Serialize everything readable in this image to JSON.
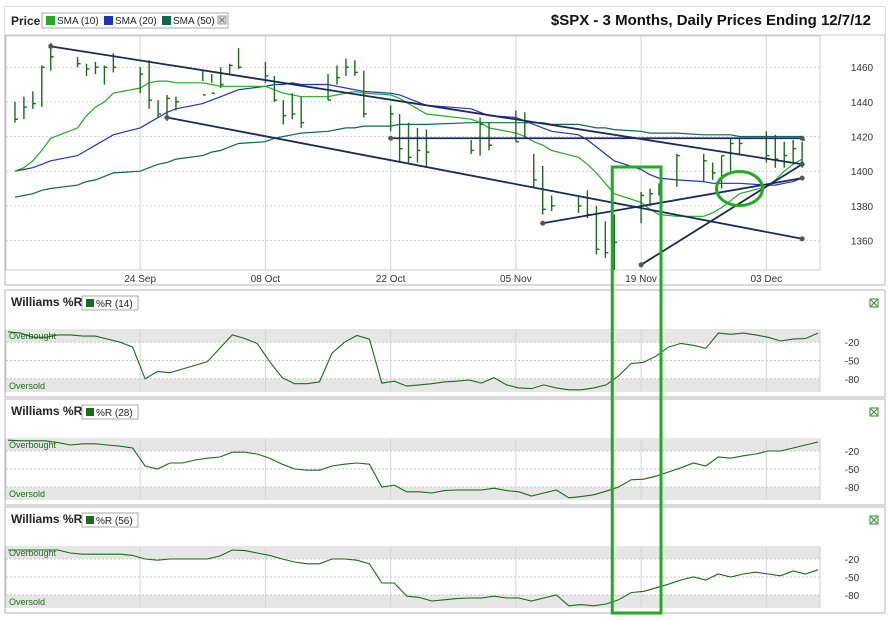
{
  "title": "$SPX - 3 Months, Daily Prices Ending 12/7/12",
  "price_panel": {
    "label": "Price",
    "legend": [
      {
        "label": "SMA (10)",
        "color": "#22aa22"
      },
      {
        "label": "SMA (20)",
        "color": "#2233bb"
      },
      {
        "label": "SMA (50)",
        "color": "#116655"
      }
    ],
    "legend_close_icon": "close-box-icon",
    "y_ticks": [
      "1460",
      "1440",
      "1420",
      "1400",
      "1380",
      "1360"
    ],
    "x_ticks": [
      "24 Sep",
      "08 Oct",
      "22 Oct",
      "05 Nov",
      "19 Nov",
      "03 Dec"
    ]
  },
  "indicator_panels": [
    {
      "title": "Williams %R",
      "legend": "%R (14)",
      "overbought": "Overbought",
      "oversold": "Oversold",
      "y_ticks": [
        "-20",
        "-50",
        "-80"
      ]
    },
    {
      "title": "Williams %R",
      "legend": "%R (28)",
      "overbought": "Overbought",
      "oversold": "Oversold",
      "y_ticks": [
        "-20",
        "-50",
        "-80"
      ]
    },
    {
      "title": "Williams %R",
      "legend": "%R (56)",
      "overbought": "Overbought",
      "oversold": "Oversold",
      "y_ticks": [
        "-20",
        "-50",
        "-80"
      ]
    }
  ],
  "colors": {
    "sma10": "#22aa22",
    "sma20": "#2233bb",
    "sma50": "#116655",
    "price_bars": "#1a6b1a",
    "wr_line": "#1a6b1a",
    "trendline": "#1a2a5a",
    "highlight": "#22aa22"
  },
  "chart_data": [
    {
      "type": "line",
      "title": "$SPX - 3 Months, Daily Prices Ending 12/7/12",
      "ylim": [
        1343,
        1478
      ],
      "grid": true,
      "dates": [
        "2012-09-10",
        "2012-09-11",
        "2012-09-12",
        "2012-09-13",
        "2012-09-14",
        "2012-09-17",
        "2012-09-18",
        "2012-09-19",
        "2012-09-20",
        "2012-09-21",
        "2012-09-24",
        "2012-09-25",
        "2012-09-26",
        "2012-09-27",
        "2012-09-28",
        "2012-10-01",
        "2012-10-02",
        "2012-10-03",
        "2012-10-04",
        "2012-10-05",
        "2012-10-08",
        "2012-10-09",
        "2012-10-10",
        "2012-10-11",
        "2012-10-12",
        "2012-10-15",
        "2012-10-16",
        "2012-10-17",
        "2012-10-18",
        "2012-10-19",
        "2012-10-22",
        "2012-10-23",
        "2012-10-24",
        "2012-10-25",
        "2012-10-26",
        "2012-10-31",
        "2012-11-01",
        "2012-11-02",
        "2012-11-05",
        "2012-11-06",
        "2012-11-07",
        "2012-11-08",
        "2012-11-09",
        "2012-11-12",
        "2012-11-13",
        "2012-11-14",
        "2012-11-15",
        "2012-11-16",
        "2012-11-19",
        "2012-11-20",
        "2012-11-21",
        "2012-11-23",
        "2012-11-26",
        "2012-11-27",
        "2012-11-28",
        "2012-11-29",
        "2012-11-30",
        "2012-12-03",
        "2012-12-04",
        "2012-12-05",
        "2012-12-06",
        "2012-12-07"
      ],
      "price_bars": {
        "high": [
          1440,
          1443,
          1446,
          1461,
          1474,
          1466,
          1462,
          1463,
          1461,
          1468,
          1460,
          1464,
          1441,
          1444,
          1443,
          1458,
          1456,
          1460,
          1462,
          1471,
          1463,
          1455,
          1441,
          1445,
          1443,
          1456,
          1461,
          1465,
          1464,
          1458,
          1438,
          1433,
          1428,
          1425,
          1424,
          1418,
          1431,
          1428,
          1435,
          1434,
          1410,
          1403,
          1386,
          1385,
          1389,
          1380,
          1371,
          1375,
          1388,
          1390,
          1393,
          1410,
          1410,
          1405,
          1409,
          1419,
          1419,
          1423,
          1421,
          1417,
          1418,
          1417
        ],
        "low": [
          1428,
          1430,
          1436,
          1437,
          1458,
          1460,
          1455,
          1456,
          1450,
          1457,
          1445,
          1436,
          1431,
          1429,
          1435,
          1452,
          1451,
          1448,
          1456,
          1459,
          1451,
          1440,
          1427,
          1430,
          1425,
          1441,
          1450,
          1455,
          1455,
          1431,
          1423,
          1405,
          1405,
          1405,
          1402,
          1410,
          1409,
          1412,
          1417,
          1419,
          1391,
          1375,
          1377,
          1376,
          1373,
          1352,
          1350,
          1343,
          1370,
          1380,
          1386,
          1391,
          1394,
          1395,
          1390,
          1400,
          1409,
          1405,
          1402,
          1402,
          1405,
          1402
        ],
        "close": [
          1430,
          1437,
          1439,
          1460,
          1466,
          1462,
          1459,
          1460,
          1460,
          1460,
          1456,
          1441,
          1433,
          1442,
          1440,
          1444,
          1445,
          1450,
          1461,
          1460,
          1455,
          1441,
          1432,
          1433,
          1428,
          1441,
          1454,
          1460,
          1457,
          1433,
          1433,
          1413,
          1408,
          1412,
          1411,
          1412,
          1427,
          1415,
          1417,
          1428,
          1395,
          1378,
          1380,
          1380,
          1375,
          1355,
          1353,
          1359,
          1386,
          1387,
          1392,
          1409,
          1406,
          1399,
          1409,
          1416,
          1416,
          1409,
          1407,
          1409,
          1413,
          1418
        ]
      },
      "series": [
        {
          "name": "SMA (10)",
          "values": [
            1400,
            1402,
            1406,
            1412,
            1419,
            1425,
            1432,
            1437,
            1440,
            1445,
            1448,
            1451,
            1452,
            1452,
            1451,
            1451,
            1450,
            1449,
            1449,
            1449,
            1449,
            1447,
            1445,
            1444,
            1443,
            1443,
            1444,
            1445,
            1446,
            1445,
            1444,
            1442,
            1439,
            1436,
            1433,
            1430,
            1428,
            1425,
            1422,
            1420,
            1417,
            1415,
            1412,
            1408,
            1404,
            1399,
            1393,
            1387,
            1382,
            1378,
            1375,
            1374,
            1374,
            1376,
            1379,
            1383,
            1387,
            1391,
            1395,
            1400,
            1404,
            1407
          ]
        },
        {
          "name": "SMA (20)",
          "values": [
            1400,
            1401,
            1402,
            1404,
            1406,
            1409,
            1412,
            1415,
            1418,
            1421,
            1425,
            1428,
            1431,
            1434,
            1436,
            1439,
            1441,
            1443,
            1445,
            1447,
            1449,
            1450,
            1450,
            1451,
            1450,
            1450,
            1449,
            1448,
            1447,
            1446,
            1445,
            1444,
            1442,
            1440,
            1438,
            1436,
            1434,
            1432,
            1431,
            1429,
            1427,
            1425,
            1423,
            1421,
            1418,
            1414,
            1410,
            1406,
            1401,
            1398,
            1396,
            1395,
            1394,
            1393,
            1393,
            1393,
            1393,
            1392,
            1392,
            1393,
            1394,
            1396
          ]
        },
        {
          "name": "SMA (50)",
          "values": [
            1385,
            1386,
            1387,
            1389,
            1390,
            1392,
            1394,
            1395,
            1397,
            1399,
            1400,
            1402,
            1404,
            1405,
            1407,
            1409,
            1411,
            1412,
            1414,
            1416,
            1417,
            1419,
            1420,
            1421,
            1422,
            1423,
            1424,
            1425,
            1425,
            1426,
            1426,
            1427,
            1427,
            1427,
            1427,
            1428,
            1428,
            1428,
            1428,
            1428,
            1428,
            1428,
            1427,
            1427,
            1426,
            1425,
            1425,
            1424,
            1423,
            1422,
            1422,
            1422,
            1421,
            1421,
            1421,
            1421,
            1420,
            1420,
            1420,
            1420,
            1420,
            1420
          ]
        }
      ],
      "trendlines": [
        {
          "from": [
            "2012-09-14",
            1472
          ],
          "to": [
            "2012-12-07",
            1404
          ]
        },
        {
          "from": [
            "2012-09-27",
            1431
          ],
          "to": [
            "2012-12-07",
            1361
          ]
        },
        {
          "from": [
            "2012-10-22",
            1419
          ],
          "to": [
            "2012-12-07",
            1419
          ]
        },
        {
          "from": [
            "2012-11-08",
            1370
          ],
          "to": [
            "2012-12-07",
            1396
          ]
        },
        {
          "from": [
            "2012-11-19",
            1346
          ],
          "to": [
            "2012-12-07",
            1404
          ]
        }
      ],
      "highlight_ellipse_center": [
        "2012-11-30",
        1390
      ],
      "highlight_column": [
        "2012-11-16",
        "2012-11-21"
      ]
    },
    {
      "type": "line",
      "legend": "%R (14)",
      "ylim": [
        -100,
        0
      ],
      "series": [
        {
          "name": "%R (14)",
          "values": [
            -3,
            -5,
            -12,
            -12,
            -8,
            -8,
            -10,
            -10,
            -15,
            -20,
            -28,
            -80,
            -68,
            -70,
            -64,
            -58,
            -52,
            -30,
            -8,
            -14,
            -22,
            -52,
            -78,
            -88,
            -88,
            -85,
            -38,
            -20,
            -9,
            -15,
            -87,
            -84,
            -92,
            -90,
            -88,
            -85,
            -84,
            -82,
            -87,
            -78,
            -90,
            -95,
            -96,
            -90,
            -95,
            -98,
            -98,
            -95,
            -90,
            -75,
            -55,
            -53,
            -43,
            -28,
            -22,
            -25,
            -30,
            -5,
            -7,
            -5,
            -8,
            -12,
            -18,
            -15,
            -14,
            -5
          ]
        }
      ]
    },
    {
      "type": "line",
      "legend": "%R (28)",
      "ylim": [
        -100,
        0
      ],
      "series": [
        {
          "name": "%R (28)",
          "values": [
            -2,
            -3,
            -3,
            -3,
            -6,
            -10,
            -8,
            -8,
            -10,
            -12,
            -15,
            -45,
            -50,
            -40,
            -40,
            -35,
            -32,
            -30,
            -22,
            -22,
            -25,
            -32,
            -42,
            -50,
            -52,
            -52,
            -45,
            -42,
            -40,
            -42,
            -80,
            -77,
            -88,
            -88,
            -90,
            -86,
            -85,
            -85,
            -85,
            -82,
            -86,
            -88,
            -95,
            -90,
            -85,
            -98,
            -96,
            -93,
            -87,
            -80,
            -68,
            -67,
            -62,
            -55,
            -48,
            -40,
            -45,
            -30,
            -32,
            -28,
            -25,
            -20,
            -20,
            -15,
            -10,
            -5
          ]
        }
      ]
    },
    {
      "type": "line",
      "legend": "%R (56)",
      "ylim": [
        -100,
        0
      ],
      "series": [
        {
          "name": "%R (56)",
          "values": [
            -5,
            -5,
            -5,
            -5,
            -5,
            -10,
            -12,
            -12,
            -12,
            -12,
            -14,
            -20,
            -22,
            -20,
            -20,
            -20,
            -20,
            -15,
            -5,
            -6,
            -10,
            -14,
            -20,
            -25,
            -28,
            -28,
            -20,
            -20,
            -22,
            -28,
            -60,
            -60,
            -82,
            -84,
            -90,
            -88,
            -86,
            -85,
            -85,
            -82,
            -85,
            -85,
            -90,
            -85,
            -80,
            -98,
            -96,
            -98,
            -95,
            -88,
            -76,
            -74,
            -68,
            -62,
            -55,
            -50,
            -55,
            -45,
            -50,
            -45,
            -42,
            -45,
            -48,
            -40,
            -45,
            -38
          ]
        }
      ]
    }
  ]
}
